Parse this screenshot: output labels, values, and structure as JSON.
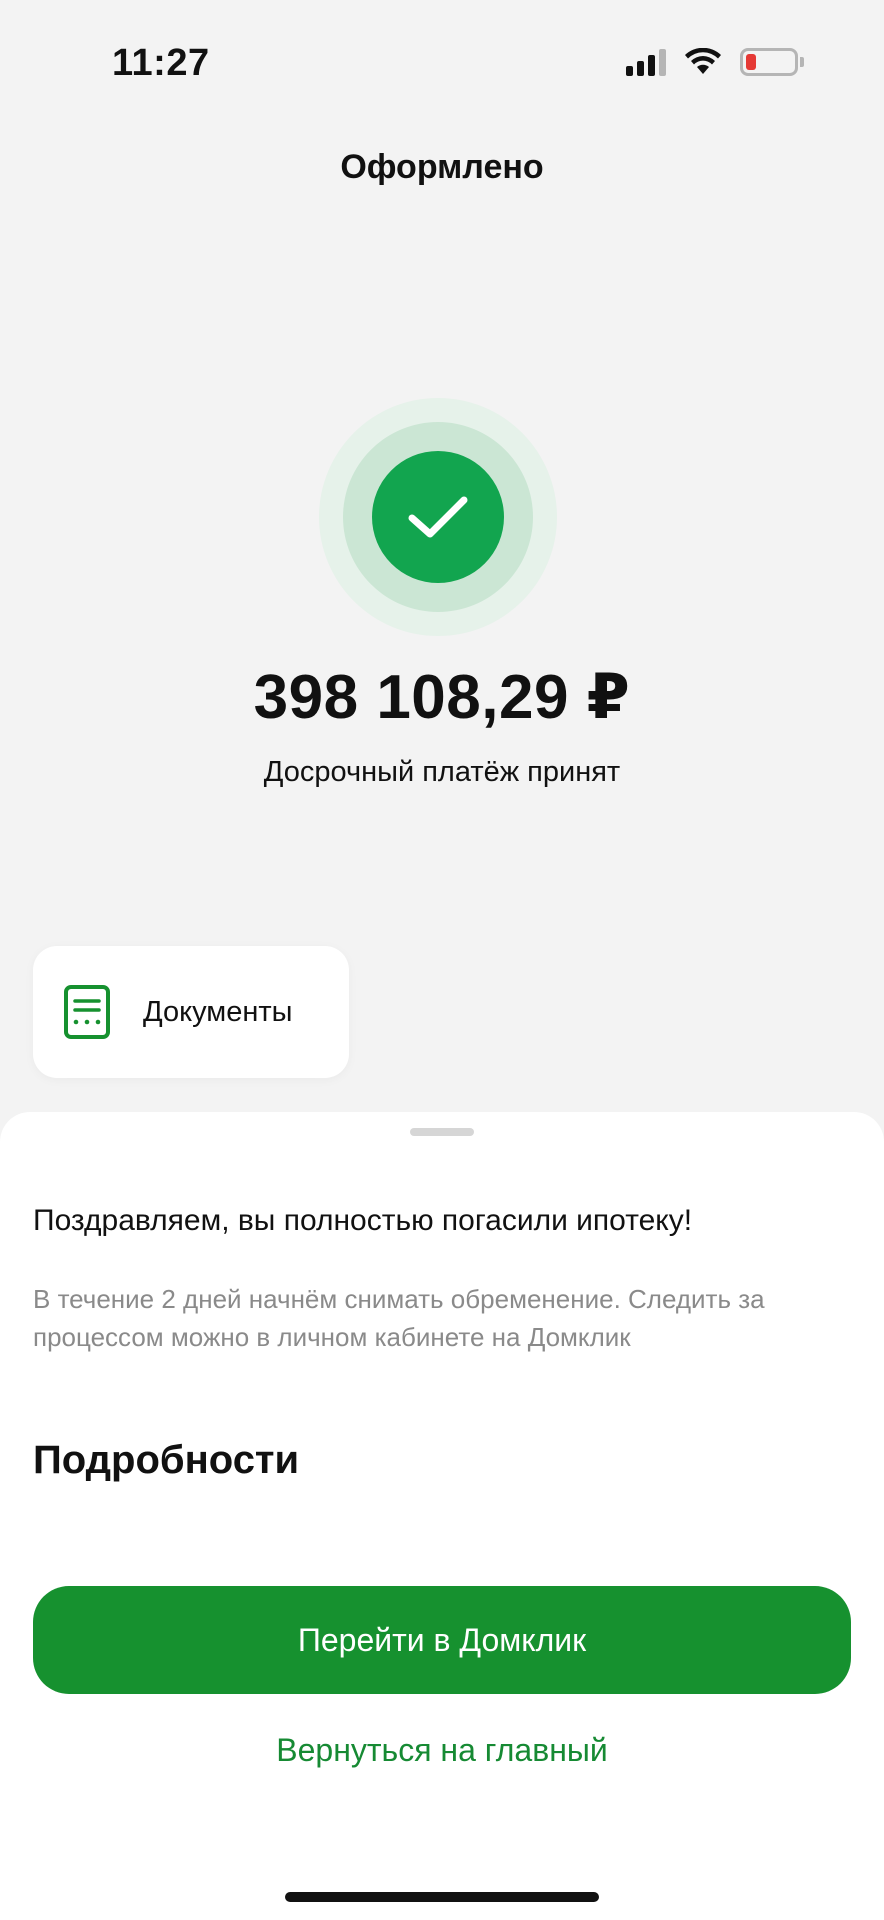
{
  "status_bar": {
    "time": "11:27",
    "battery_level": 0.15,
    "battery_color": "#e53935"
  },
  "header": {
    "title": "Оформлено"
  },
  "result": {
    "icon": "checkmark-icon",
    "status_color": "#12a54f",
    "amount": "398 108,29 ₽",
    "caption": "Досрочный платёж принят"
  },
  "documents": {
    "icon": "document-icon",
    "label": "Документы"
  },
  "sheet": {
    "title": "Поздравляем, вы полностью погасили ипотеку!",
    "description": "В течение 2 дней начнём снимать обременение. Следить за процессом можно в личном кабинете на Домклик",
    "details_heading": "Подробности",
    "primary_button": "Перейти в Домклик",
    "secondary_link": "Вернуться на главный",
    "accent_color": "#16912f"
  }
}
